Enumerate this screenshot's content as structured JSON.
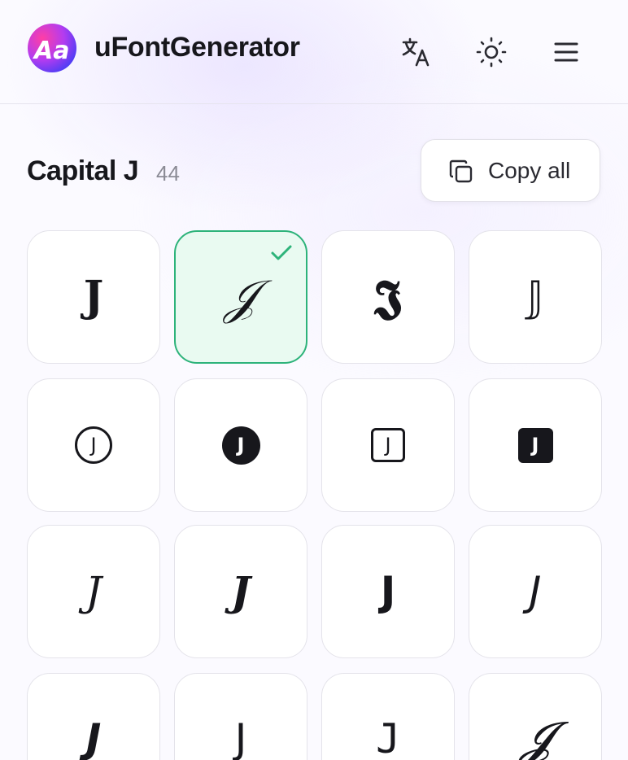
{
  "app": {
    "name": "uFontGenerator",
    "logo_glyph": "Aa",
    "accent": "#2db37a"
  },
  "header": {
    "icons": [
      "translate-icon",
      "sun-icon",
      "menu-icon"
    ]
  },
  "section": {
    "title": "Capital J",
    "count": "44",
    "copy_all_label": "Copy all"
  },
  "glyphs": [
    {
      "char": "𝐉",
      "style": "serif-bold",
      "selected": false
    },
    {
      "char": "𝒥",
      "style": "script",
      "selected": true
    },
    {
      "char": "𝕵",
      "style": "fraktur-bold",
      "selected": false
    },
    {
      "char": "𝕁",
      "style": "double-struck",
      "selected": false
    },
    {
      "char": "J",
      "style": "circled",
      "selected": false
    },
    {
      "char": "J",
      "style": "negative-circled",
      "selected": false
    },
    {
      "char": "J",
      "style": "squared",
      "selected": false
    },
    {
      "char": "J",
      "style": "negative-squared",
      "selected": false
    },
    {
      "char": "𝐽",
      "style": "serif-italic",
      "selected": false
    },
    {
      "char": "𝑱",
      "style": "serif-bold-italic",
      "selected": false
    },
    {
      "char": "𝗝",
      "style": "sans-bold",
      "selected": false
    },
    {
      "char": "𝘑",
      "style": "sans-italic",
      "selected": false
    },
    {
      "char": "𝙅",
      "style": "sans-bold-italic",
      "selected": false
    },
    {
      "char": "𝖩",
      "style": "sans",
      "selected": false
    },
    {
      "char": "𝙹",
      "style": "monospace",
      "selected": false
    },
    {
      "char": "𝓙",
      "style": "bold-script",
      "selected": false
    }
  ]
}
